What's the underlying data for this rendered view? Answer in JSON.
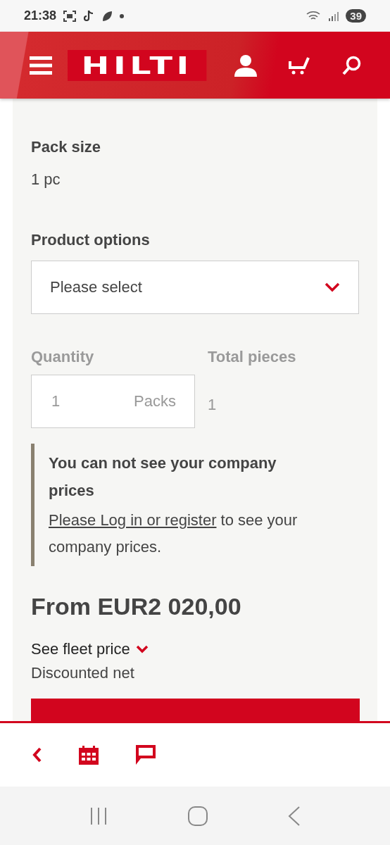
{
  "status_bar": {
    "time": "21:38",
    "battery": "39"
  },
  "header": {
    "logo": "HILTI"
  },
  "pack_size": {
    "label": "Pack size",
    "value": "1 pc"
  },
  "product_options": {
    "label": "Product options",
    "placeholder": "Please select"
  },
  "quantity": {
    "label": "Quantity",
    "value": "1",
    "unit": "Packs",
    "disabled": true
  },
  "total_pieces": {
    "label": "Total pieces",
    "value": "1"
  },
  "notice": {
    "title": "You can not see your company prices",
    "link": "Please Log in or register",
    "text": " to see your company prices."
  },
  "price": "From EUR2 020,00",
  "fleet_price": {
    "label": "See fleet price",
    "expanded": false
  },
  "price_note": "Discounted net"
}
